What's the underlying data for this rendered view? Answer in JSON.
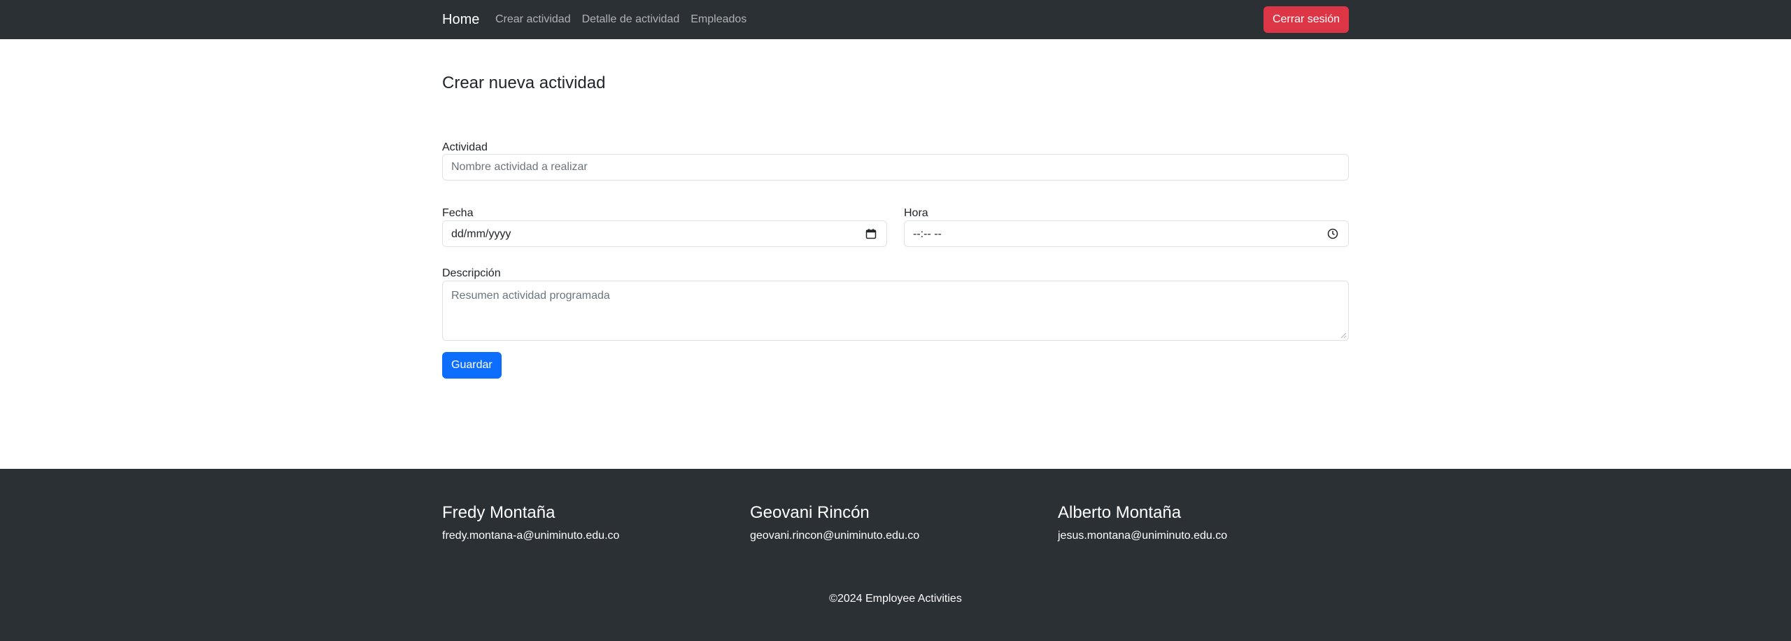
{
  "nav": {
    "brand": "Home",
    "links": [
      "Crear actividad",
      "Detalle de actividad",
      "Empleados"
    ],
    "logout_label": "Cerrar sesión"
  },
  "form": {
    "title": "Crear nueva actividad",
    "actividad_label": "Actividad",
    "actividad_placeholder": "Nombre actividad a realizar",
    "fecha_label": "Fecha",
    "fecha_value": "dd/mm/yyyy",
    "hora_label": "Hora",
    "hora_value": "--:-- --",
    "descripcion_label": "Descripción",
    "descripcion_placeholder": "Resumen actividad programada",
    "save_label": "Guardar"
  },
  "footer": {
    "contacts": [
      {
        "name": "Fredy Montaña",
        "email": "fredy.montana-a@uniminuto.edu.co"
      },
      {
        "name": "Geovani Rincón",
        "email": "geovani.rincon@uniminuto.edu.co"
      },
      {
        "name": "Alberto Montaña",
        "email": "jesus.montana@uniminuto.edu.co"
      }
    ],
    "copyright": "©2024 Employee Activities"
  },
  "colors": {
    "navbar_bg": "#2b3035",
    "logout_button": "#dc3545",
    "save_button": "#0d6efd"
  },
  "icons": [
    "calendar-icon",
    "clock-icon"
  ]
}
